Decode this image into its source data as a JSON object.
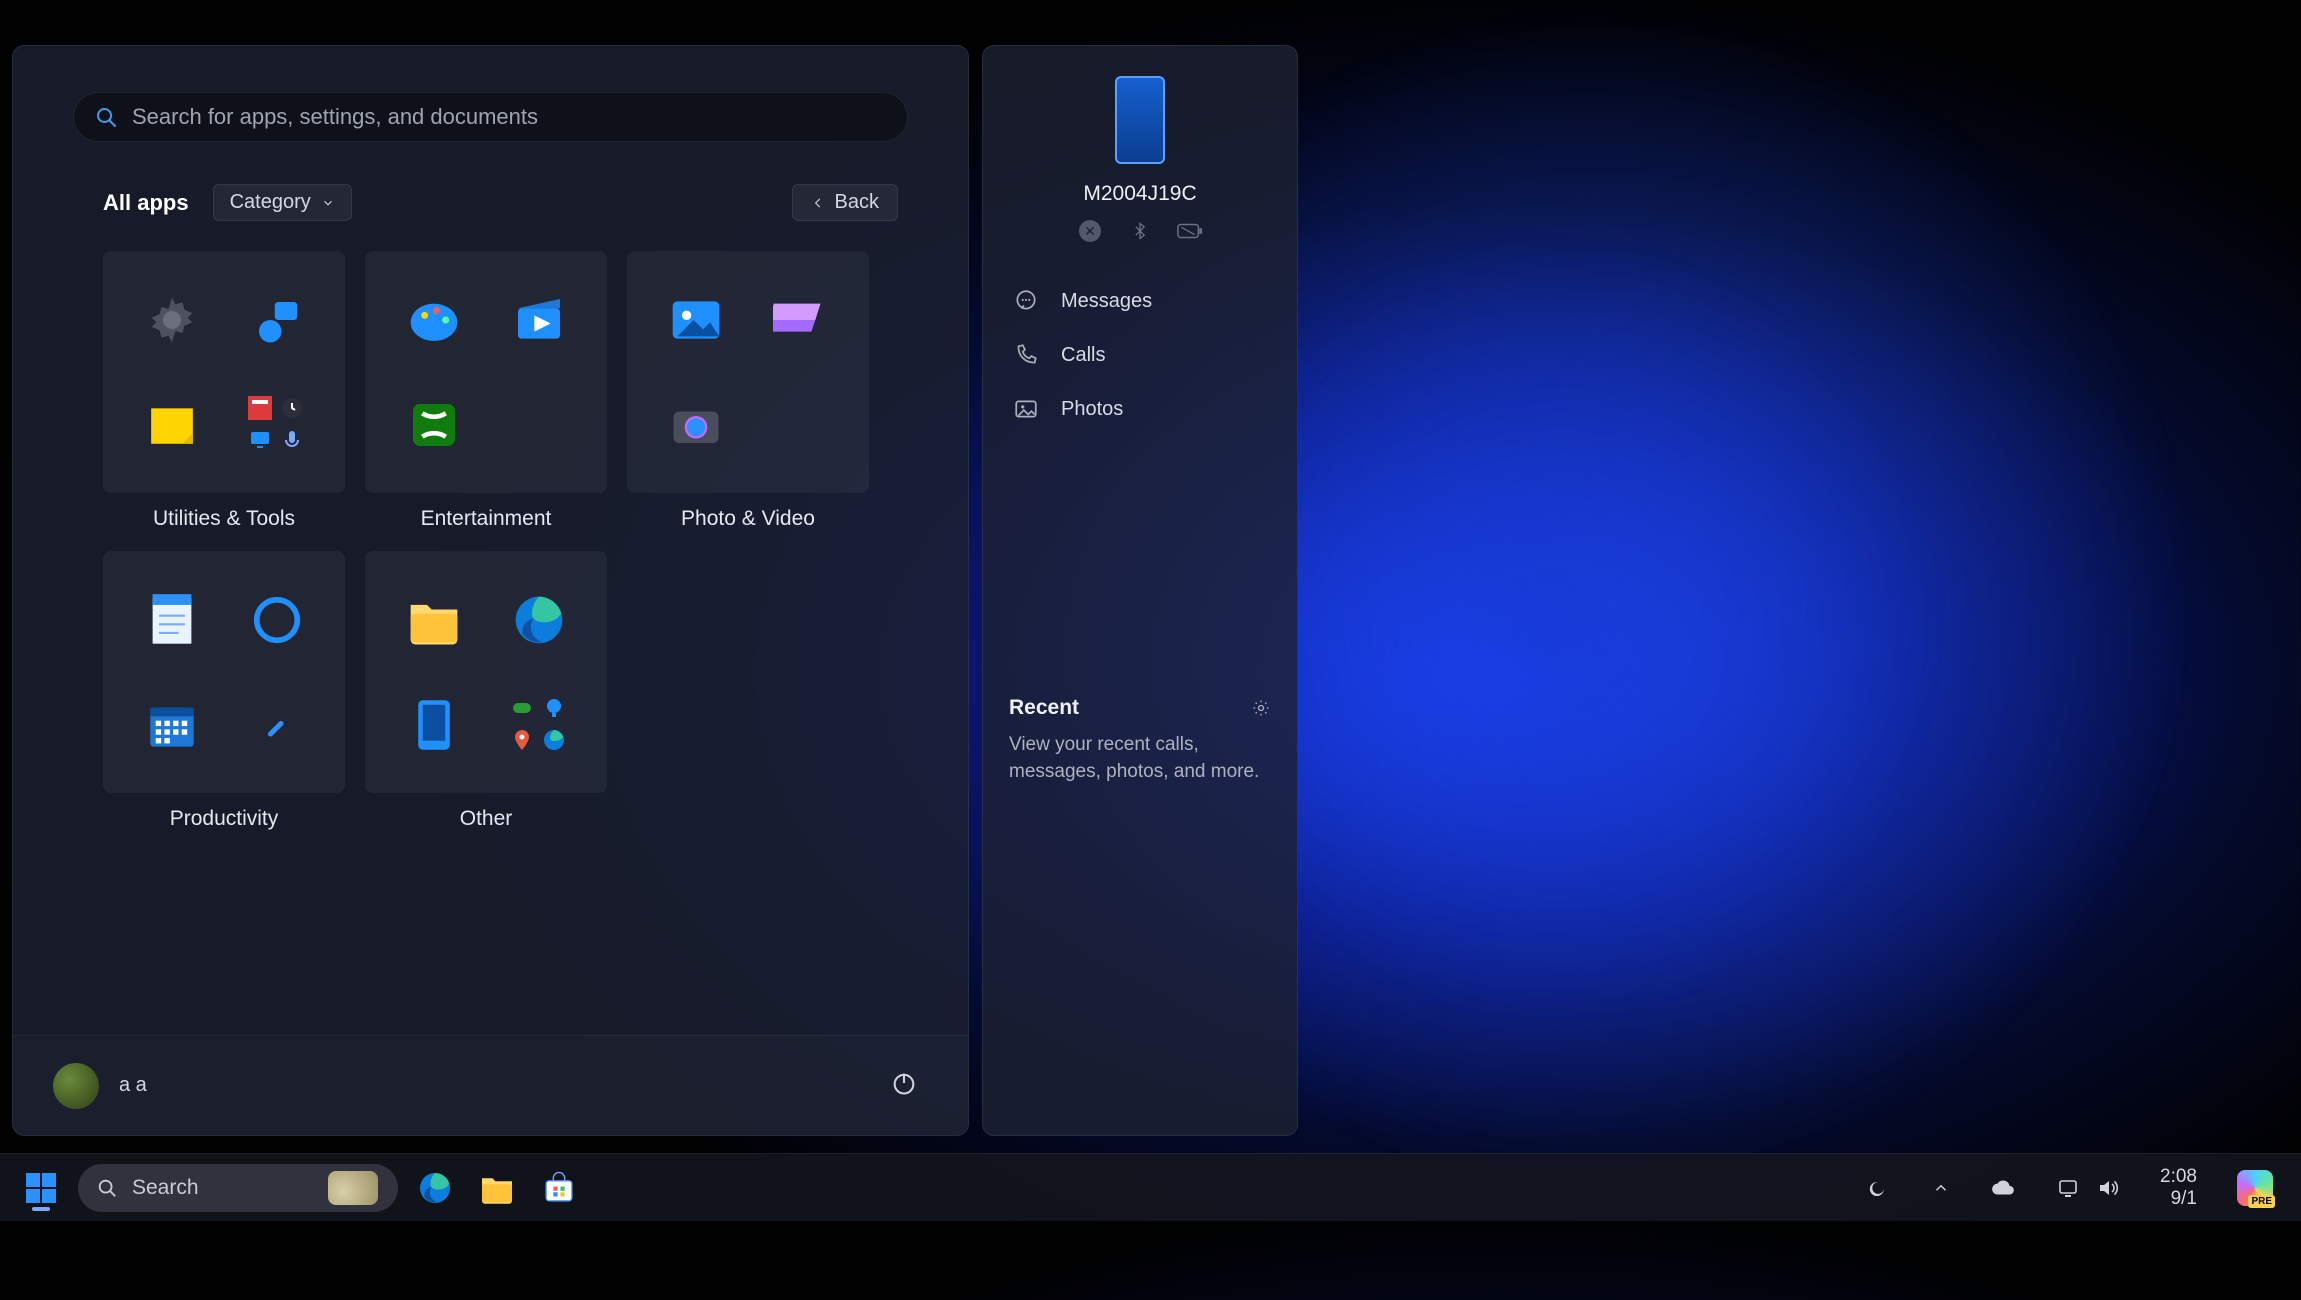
{
  "search": {
    "placeholder": "Search for apps, settings, and documents"
  },
  "heading": "All apps",
  "category_label": "Category",
  "back_label": "Back",
  "folders": [
    {
      "label": "Utilities & Tools"
    },
    {
      "label": "Entertainment"
    },
    {
      "label": "Photo & Video"
    },
    {
      "label": "Productivity"
    },
    {
      "label": "Other"
    }
  ],
  "user": {
    "name": "a a"
  },
  "companion": {
    "device_name": "M2004J19C",
    "rows": {
      "messages": "Messages",
      "calls": "Calls",
      "photos": "Photos"
    },
    "recent_title": "Recent",
    "recent_sub": "View your recent calls, messages, photos, and more."
  },
  "taskbar": {
    "search_label": "Search",
    "clock_time": "2:08",
    "clock_date": "9/1"
  }
}
